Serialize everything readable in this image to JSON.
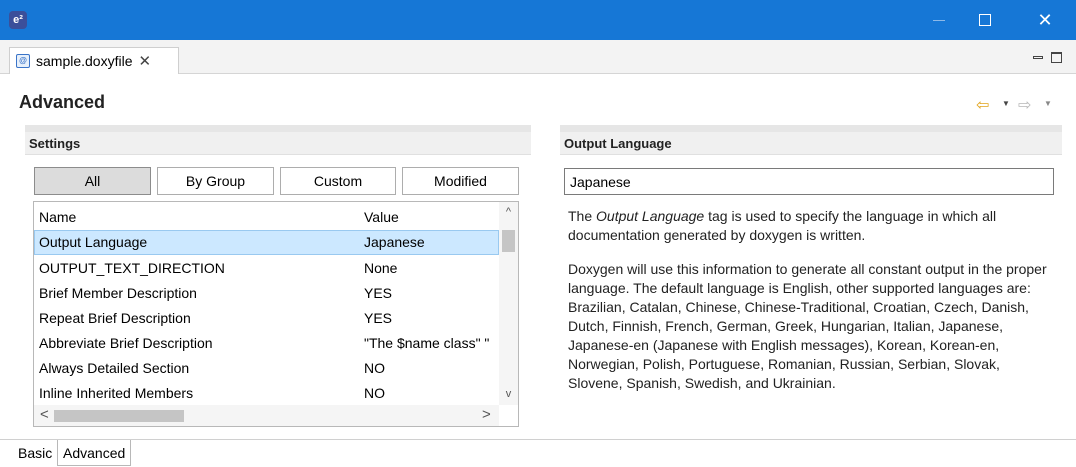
{
  "window": {
    "app_icon": "e²",
    "minimize_icon": "minimize-icon",
    "maximize_icon": "maximize-icon",
    "close_icon": "✕"
  },
  "editor_tab": {
    "file_icon": "doxyfile-icon",
    "label": "sample.doxyfile",
    "close": "✕"
  },
  "page": {
    "title": "Advanced",
    "nav_back": "⇦",
    "nav_forward": "⇨",
    "dropdown": "▼"
  },
  "settings": {
    "header": "Settings",
    "filters": [
      {
        "label": "All",
        "active": true
      },
      {
        "label": "By Group",
        "active": false
      },
      {
        "label": "Custom",
        "active": false
      },
      {
        "label": "Modified",
        "active": false
      }
    ],
    "columns": [
      "Name",
      "Value"
    ],
    "rows": [
      {
        "name": "Output Language",
        "value": "Japanese",
        "selected": true
      },
      {
        "name": "OUTPUT_TEXT_DIRECTION",
        "value": "None"
      },
      {
        "name": "Brief Member Description",
        "value": "YES"
      },
      {
        "name": "Repeat Brief Description",
        "value": "YES"
      },
      {
        "name": "Abbreviate Brief Description",
        "value": "\"The $name class\" \""
      },
      {
        "name": "Always Detailed Section",
        "value": "NO"
      },
      {
        "name": "Inline Inherited Members",
        "value": "NO"
      }
    ],
    "scroll_up": "^",
    "scroll_down": "v",
    "scroll_left": "<",
    "scroll_right": ">"
  },
  "detail": {
    "header": "Output Language",
    "value": "Japanese",
    "desc1_pre": "The ",
    "desc1_em": "Output Language",
    "desc1_post": " tag is used to specify the language in which all documentation generated by doxygen is written.",
    "desc2": "Doxygen will use this information to generate all constant output in the proper language. The default language is English, other supported languages are: Brazilian, Catalan, Chinese, Chinese-Traditional, Croatian, Czech, Danish, Dutch, Finnish, French, German, Greek, Hungarian, Italian, Japanese, Japanese-en (Japanese with English messages), Korean, Korean-en, Norwegian, Polish, Portuguese, Romanian, Russian, Serbian, Slovak, Slovene, Spanish, Swedish, and Ukrainian."
  },
  "bottom_tabs": [
    {
      "label": "Basic",
      "active": false
    },
    {
      "label": "Advanced",
      "active": true
    }
  ],
  "colors": {
    "titlebar": "#1677d6",
    "selection": "#cce8ff",
    "nav_back": "#e2a51d"
  }
}
